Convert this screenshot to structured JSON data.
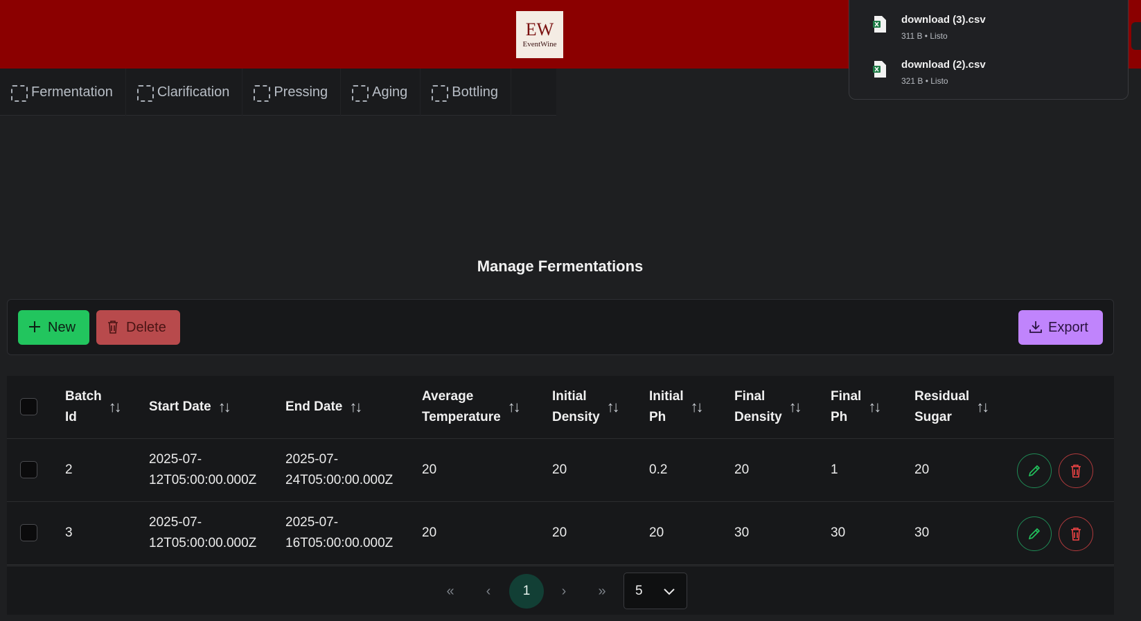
{
  "header": {
    "logo_mark": "EW",
    "logo_text": "EventWine"
  },
  "tabs": [
    {
      "label": "Fermentation"
    },
    {
      "label": "Clarification"
    },
    {
      "label": "Pressing"
    },
    {
      "label": "Aging"
    },
    {
      "label": "Bottling"
    }
  ],
  "page_title": "Manage Fermentations",
  "toolbar": {
    "new_label": "New",
    "delete_label": "Delete",
    "export_label": "Export"
  },
  "table": {
    "columns": [
      [
        "Batch",
        "Id"
      ],
      [
        "Start Date"
      ],
      [
        "End Date"
      ],
      [
        "Average",
        "Temperature"
      ],
      [
        "Initial",
        "Density"
      ],
      [
        "Initial",
        "Ph"
      ],
      [
        "Final",
        "Density"
      ],
      [
        "Final",
        "Ph"
      ],
      [
        "Residual",
        "Sugar"
      ]
    ],
    "rows": [
      {
        "batch_id": "2",
        "start_date": [
          "2025-07-",
          "12T05:00:00.000Z"
        ],
        "end_date": [
          "2025-07-",
          "24T05:00:00.000Z"
        ],
        "average_temperature": "20",
        "initial_density": "20",
        "initial_ph": "0.2",
        "final_density": "20",
        "final_ph": "1",
        "residual_sugar": "20"
      },
      {
        "batch_id": "3",
        "start_date": [
          "2025-07-",
          "12T05:00:00.000Z"
        ],
        "end_date": [
          "2025-07-",
          "16T05:00:00.000Z"
        ],
        "average_temperature": "20",
        "initial_density": "20",
        "initial_ph": "20",
        "final_density": "30",
        "final_ph": "30",
        "residual_sugar": "30"
      }
    ]
  },
  "pagination": {
    "first": "«",
    "prev": "‹",
    "current_page": "1",
    "next": "›",
    "last": "»",
    "rows_per_page": "5"
  },
  "downloads": [
    {
      "name": "download (3).csv",
      "meta": "311 B • Listo",
      "icon": "excel-file-icon"
    },
    {
      "name": "download (2).csv",
      "meta": "321 B • Listo",
      "icon": "excel-file-icon"
    }
  ],
  "colors": {
    "header_bg": "#8b0000",
    "new_button": "#22c55e",
    "delete_button": "#b84a4c",
    "export_button": "#c084fc",
    "current_page": "#123f35"
  }
}
